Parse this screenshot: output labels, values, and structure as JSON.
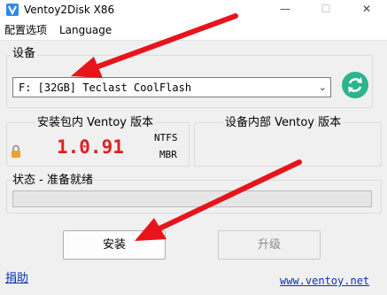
{
  "window": {
    "title": "Ventoy2Disk  X86",
    "minimize_glyph": "—",
    "maximize_glyph": "☐",
    "close_glyph": "✕"
  },
  "menu": {
    "items": [
      {
        "label": "配置选项"
      },
      {
        "label": "Language"
      }
    ]
  },
  "device": {
    "group_label": "设备",
    "selected": "F: [32GB] Teclast CoolFlash",
    "dropdown_glyph": "⌄",
    "refresh_icon": "refresh-icon"
  },
  "package_version": {
    "label": "安装包内 Ventoy 版本",
    "value": "1.0.91",
    "filesystem": "NTFS",
    "partition_style": "MBR",
    "lock_icon": "lock-icon"
  },
  "device_version": {
    "label": "设备内部 Ventoy 版本",
    "value": ""
  },
  "status": {
    "label": "状态 - 准备就绪",
    "progress": 0
  },
  "buttons": {
    "install": "安装",
    "update": "升级"
  },
  "links": {
    "donate": "捐助",
    "website": "www.ventoy.net"
  },
  "colors": {
    "version_red": "#e02020",
    "refresh_green": "#2bb58c",
    "annotation_arrow": "#e8141c",
    "link_blue": "#0a33b3"
  }
}
